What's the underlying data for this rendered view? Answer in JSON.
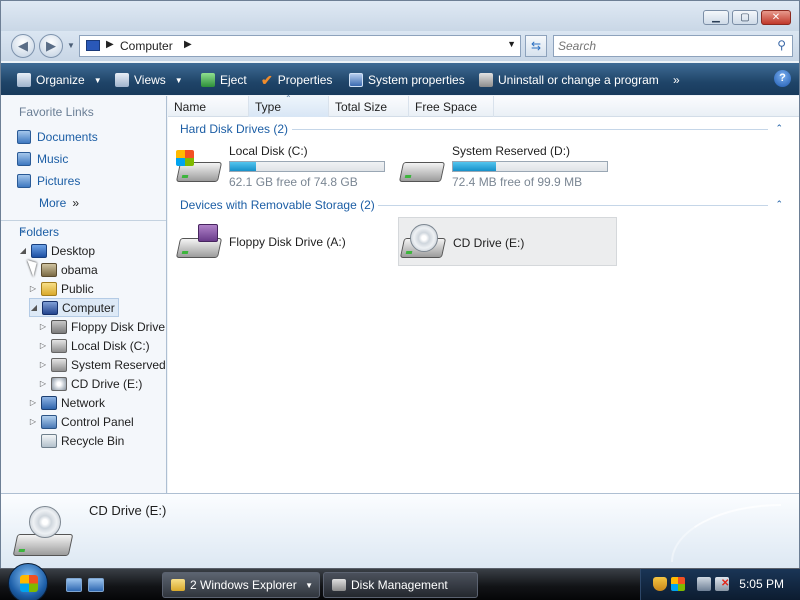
{
  "window": {
    "address": {
      "crumb": "Computer"
    },
    "search": {
      "placeholder": "Search"
    },
    "toolbar": {
      "organize": "Organize",
      "views": "Views",
      "eject": "Eject",
      "properties": "Properties",
      "system_properties": "System properties",
      "uninstall": "Uninstall or change a program",
      "more": "»",
      "help": "?"
    }
  },
  "navpane": {
    "favorites_title": "Favorite Links",
    "favorites": [
      "Documents",
      "Music",
      "Pictures"
    ],
    "more": "More",
    "more_chevron": "»",
    "folders_title": "Folders",
    "tree": {
      "desktop": "Desktop",
      "obama": "obama",
      "public": "Public",
      "computer": "Computer",
      "floppy": "Floppy Disk Drive",
      "local_c": "Local Disk (C:)",
      "system_reserved": "System Reserved (",
      "cd_e": "CD Drive (E:)",
      "network": "Network",
      "control_panel": "Control Panel",
      "recycle_bin": "Recycle Bin"
    }
  },
  "columns": [
    "Name",
    "Type",
    "Total Size",
    "Free Space"
  ],
  "groups": {
    "hdd": "Hard Disk Drives (2)",
    "removable": "Devices with Removable Storage (2)"
  },
  "drives": {
    "c": {
      "name": "Local Disk (C:)",
      "free_text": "62.1 GB free of 74.8 GB",
      "used_fraction": 0.17
    },
    "d": {
      "name": "System Reserved (D:)",
      "free_text": "72.4 MB free of 99.9 MB",
      "used_fraction": 0.28
    },
    "a": {
      "name": "Floppy Disk Drive (A:)"
    },
    "e": {
      "name": "CD Drive (E:)"
    }
  },
  "details": {
    "title": "CD Drive (E:)"
  },
  "taskbar": {
    "explorer": "2 Windows Explorer",
    "disk_mgmt": "Disk Management",
    "clock": "5:05 PM"
  },
  "colors": {
    "toolbar": "#1f4468",
    "link": "#1c5ea5",
    "progress": "#1690c9"
  }
}
